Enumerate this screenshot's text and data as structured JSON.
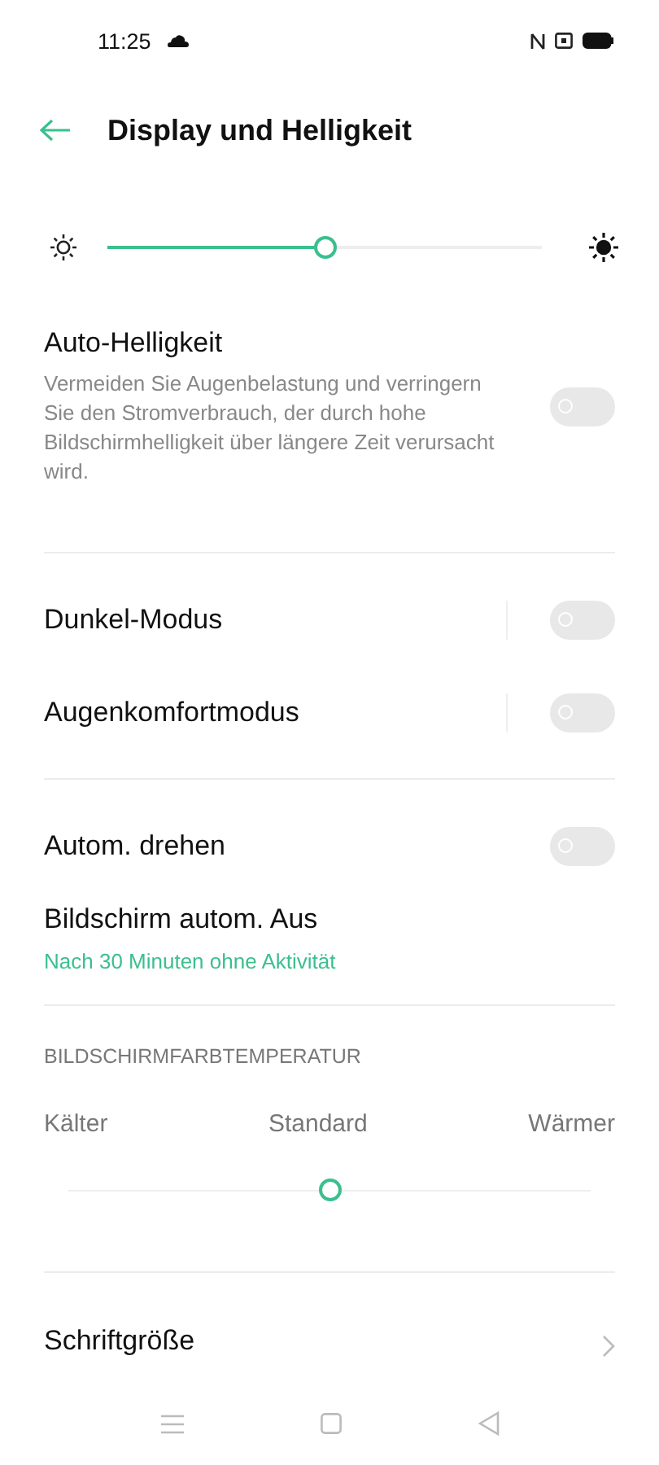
{
  "status_bar": {
    "time": "11:25"
  },
  "header": {
    "title": "Display und Helligkeit"
  },
  "brightness": {
    "level": 0.5
  },
  "groups": [
    {
      "items": [
        {
          "kind": "toggle",
          "title": "Auto-Helligkeit",
          "description": "Vermeiden Sie Augenbelastung und verringern Sie den Stromverbrauch, der durch hohe Bildschirmhelligkeit über längere Zeit verursacht wird.",
          "on": false,
          "separator": false
        }
      ]
    },
    {
      "items": [
        {
          "kind": "toggle",
          "title": "Dunkel-Modus",
          "on": false,
          "separator": true
        },
        {
          "kind": "toggle",
          "title": "Augenkomfortmodus",
          "on": false,
          "separator": true
        }
      ]
    },
    {
      "items": [
        {
          "kind": "toggle",
          "title": "Autom. drehen",
          "on": false,
          "separator": false
        },
        {
          "kind": "value",
          "title": "Bildschirm autom. Aus",
          "value": "Nach 30 Minuten ohne Aktivität"
        }
      ]
    }
  ],
  "color_temperature": {
    "heading": "BILDSCHIRMFARBTEMPERATUR",
    "labels": [
      "Kälter",
      "Standard",
      "Wärmer"
    ],
    "level": 0.5
  },
  "bottom_items": [
    {
      "kind": "nav",
      "title": "Schriftgröße"
    }
  ]
}
